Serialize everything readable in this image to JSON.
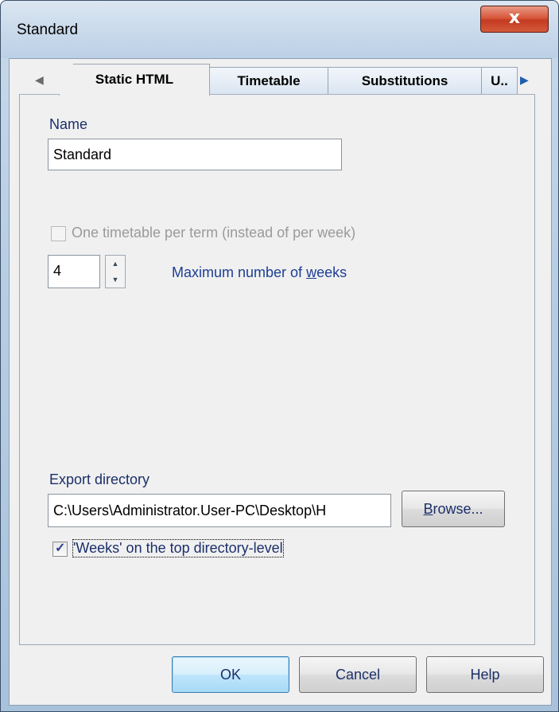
{
  "window": {
    "title": "Standard",
    "close_glyph": "x"
  },
  "tabs": {
    "items": [
      {
        "label": "Static HTML"
      },
      {
        "label": "Timetable"
      },
      {
        "label": "Substitutions"
      },
      {
        "label": "U.."
      }
    ],
    "active_index": 0,
    "left_arrow": "◀",
    "right_arrow": "▶"
  },
  "name": {
    "label": "Name",
    "value": "Standard"
  },
  "one_timetable": {
    "label": "One timetable per term (instead of per week)",
    "checked": false,
    "enabled": false
  },
  "weeks": {
    "value": "4",
    "label_pre": "Maximum number of ",
    "label_hot": "w",
    "label_post": "eeks",
    "up": "▲",
    "down": "▼"
  },
  "export": {
    "label": "Export directory",
    "value": "C:\\Users\\Administrator.User-PC\\Desktop\\H",
    "browse_hot": "B",
    "browse_rest": "rowse..."
  },
  "weeks_top": {
    "label": "'Weeks' on the top directory-level",
    "checked": true,
    "check_glyph": "✓"
  },
  "buttons": {
    "ok": "OK",
    "cancel": "Cancel",
    "help": "Help"
  },
  "colors": {
    "label_blue": "#1c3e95",
    "close_red": "#c43a1f",
    "dialog_bg": "#f0f0f0"
  }
}
